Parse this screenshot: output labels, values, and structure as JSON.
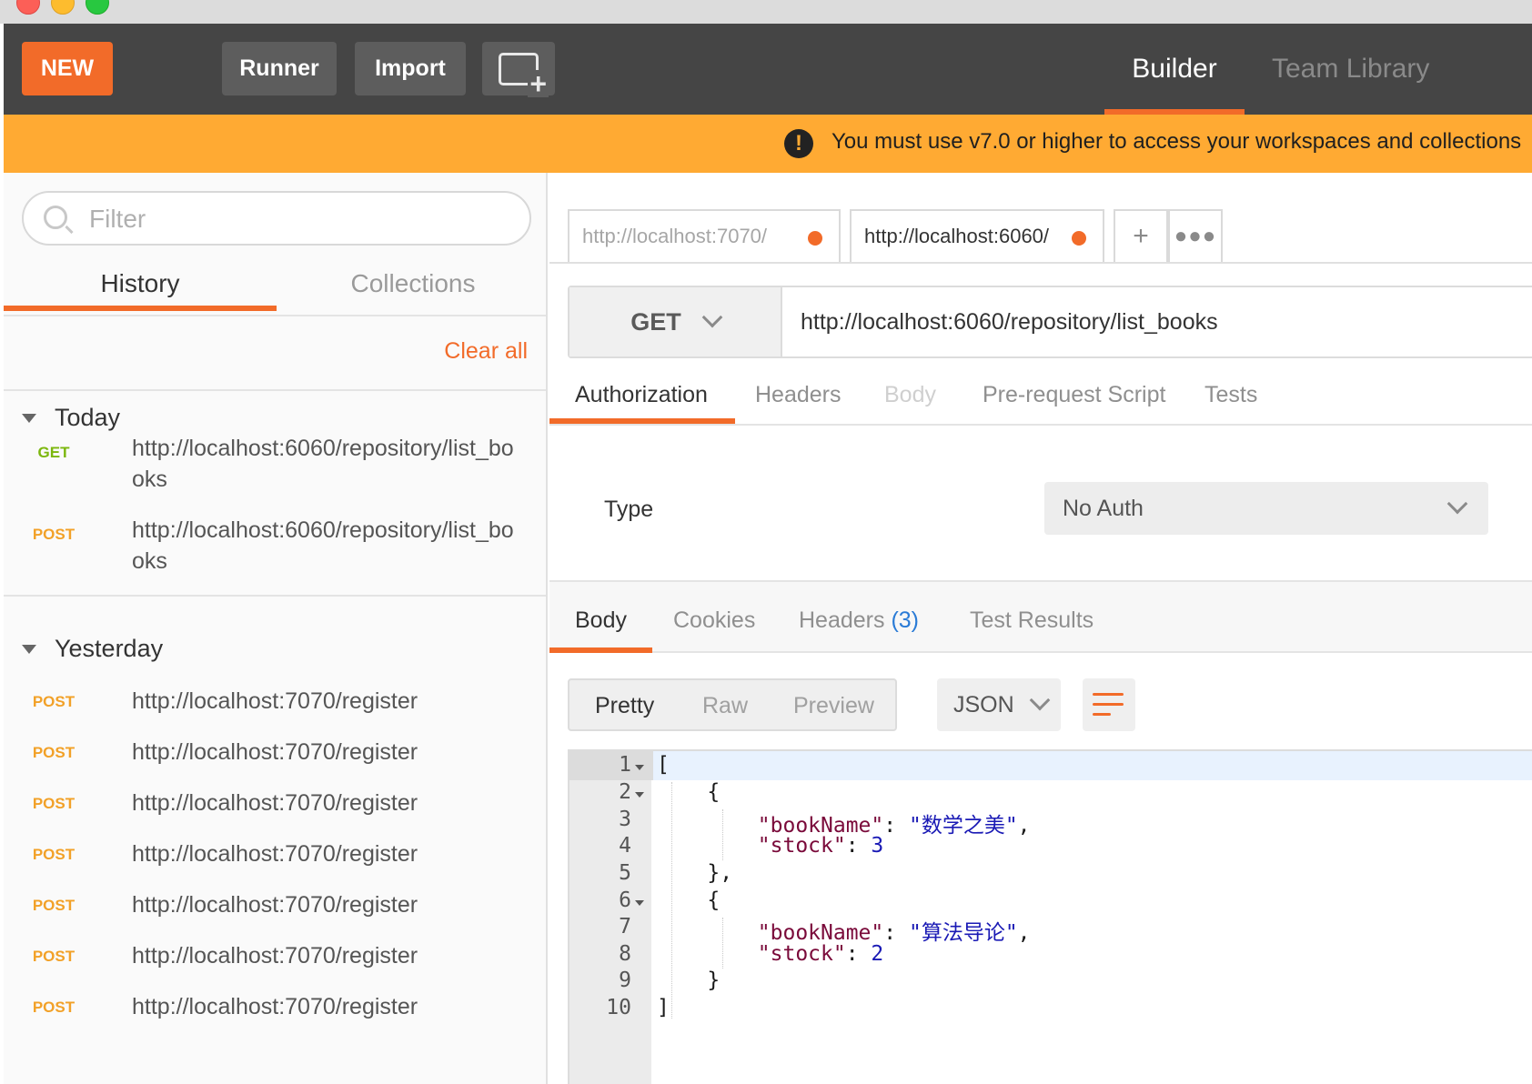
{
  "toolbar": {
    "new_label": "NEW",
    "runner_label": "Runner",
    "import_label": "Import",
    "tabs": {
      "builder": "Builder",
      "team_library": "Team Library"
    }
  },
  "banner": {
    "text": "You must use v7.0 or higher to access your workspaces and collections",
    "icon": "exclamation-icon"
  },
  "sidebar": {
    "filter_placeholder": "Filter",
    "tabs": {
      "history": "History",
      "collections": "Collections"
    },
    "clear_all": "Clear all",
    "groups": [
      {
        "title": "Today",
        "items": [
          {
            "method": "GET",
            "url": "http://localhost:6060/repository/list_books"
          },
          {
            "method": "POST",
            "url": "http://localhost:6060/repository/list_books"
          }
        ]
      },
      {
        "title": "Yesterday",
        "items": [
          {
            "method": "POST",
            "url": "http://localhost:7070/register"
          },
          {
            "method": "POST",
            "url": "http://localhost:7070/register"
          },
          {
            "method": "POST",
            "url": "http://localhost:7070/register"
          },
          {
            "method": "POST",
            "url": "http://localhost:7070/register"
          },
          {
            "method": "POST",
            "url": "http://localhost:7070/register"
          },
          {
            "method": "POST",
            "url": "http://localhost:7070/register"
          },
          {
            "method": "POST",
            "url": "http://localhost:7070/register"
          }
        ]
      }
    ]
  },
  "request_tabs": [
    {
      "label": "http://localhost:7070/",
      "unsaved": true
    },
    {
      "label": "http://localhost:6060/",
      "unsaved": true
    }
  ],
  "request": {
    "method": "GET",
    "url": "http://localhost:6060/repository/list_books",
    "tabs": [
      "Authorization",
      "Headers",
      "Body",
      "Pre-request Script",
      "Tests"
    ],
    "auth_type_label": "Type",
    "auth_type_value": "No Auth"
  },
  "response": {
    "tabs": {
      "body": "Body",
      "cookies": "Cookies",
      "headers": "Headers",
      "headers_count": "(3)",
      "test_results": "Test Results"
    },
    "view_modes": [
      "Pretty",
      "Raw",
      "Preview"
    ],
    "format": "JSON",
    "line_numbers": [
      "1",
      "2",
      "3",
      "4",
      "5",
      "6",
      "7",
      "8",
      "9",
      "10"
    ],
    "books": [
      {
        "key_name": "\"bookName\"",
        "name": "\"数学之美\"",
        "key_stock": "\"stock\"",
        "stock": "3"
      },
      {
        "key_name": "\"bookName\"",
        "name": "\"算法导论\"",
        "key_stock": "\"stock\"",
        "stock": "2"
      }
    ]
  },
  "colors": {
    "accent": "#f26b29",
    "toolbar": "#454545",
    "banner": "#ffaa33",
    "get": "#7cb70e",
    "post": "#f2a128"
  }
}
